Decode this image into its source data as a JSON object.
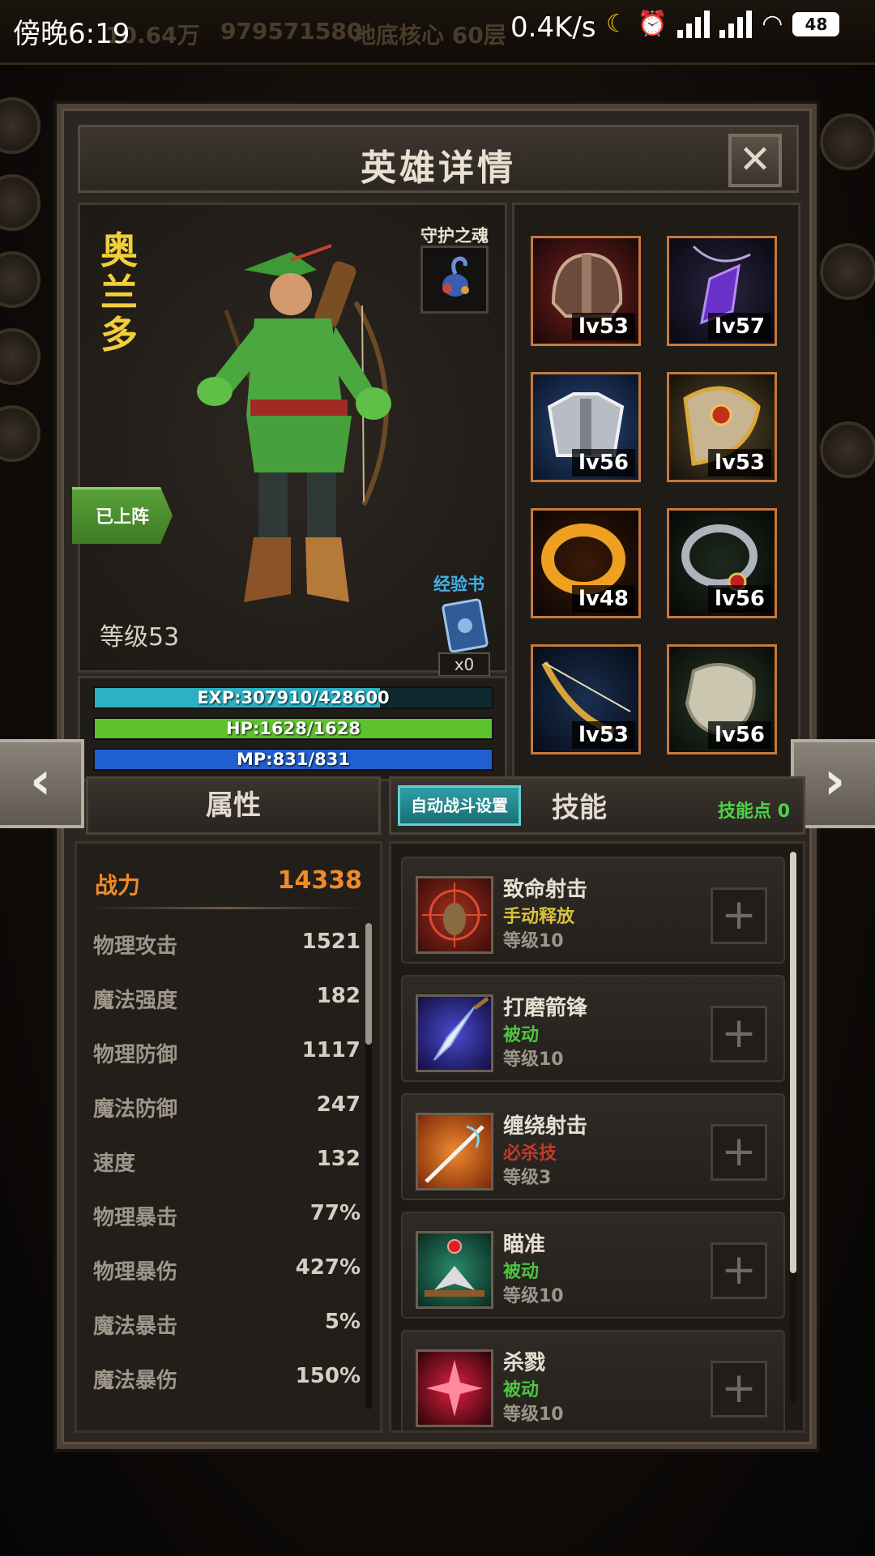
{
  "status_bar": {
    "time": "傍晚6:19",
    "network_speed": "0.4K/s",
    "battery": "48"
  },
  "background_top": {
    "gold": "10.64万",
    "diamonds": "979571580",
    "location": "地底核心 60层"
  },
  "dialog": {
    "title": "英雄详情",
    "close_label": "✕"
  },
  "hero": {
    "name": "奥兰多",
    "deployed_label": "已上阵",
    "guardian_label": "守护之魂",
    "level_text": "等级53",
    "exp_book_label": "经验书",
    "exp_book_count": "x0",
    "exp_text": "EXP:307910/428600",
    "exp_fraction": 0.718,
    "hp_text": "HP:1628/1628",
    "hp_fraction": 1.0,
    "mp_text": "MP:831/831",
    "mp_fraction": 1.0
  },
  "equipment": [
    {
      "icon": "helmet-icon",
      "level": "lv53"
    },
    {
      "icon": "amulet-icon",
      "level": "lv57"
    },
    {
      "icon": "armor-icon",
      "level": "lv56"
    },
    {
      "icon": "shoulder-icon",
      "level": "lv53"
    },
    {
      "icon": "ring-gold-icon",
      "level": "lv48"
    },
    {
      "icon": "ring-silver-icon",
      "level": "lv56"
    },
    {
      "icon": "bow-icon",
      "level": "lv53"
    },
    {
      "icon": "boots-icon",
      "level": "lv56"
    }
  ],
  "navigation": {
    "prev_label": "‹",
    "next_label": "›"
  },
  "attributes": {
    "tab_label": "属性",
    "power_label": "战力",
    "power_value": "14338",
    "rows": [
      {
        "label": "物理攻击",
        "value": "1521"
      },
      {
        "label": "魔法强度",
        "value": "182"
      },
      {
        "label": "物理防御",
        "value": "1117"
      },
      {
        "label": "魔法防御",
        "value": "247"
      },
      {
        "label": "速度",
        "value": "132"
      },
      {
        "label": "物理暴击",
        "value": "77%"
      },
      {
        "label": "物理暴伤",
        "value": "427%"
      },
      {
        "label": "魔法暴击",
        "value": "5%"
      },
      {
        "label": "魔法暴伤",
        "value": "150%"
      }
    ]
  },
  "skills": {
    "auto_battle_label": "自动战斗设置",
    "tab_label": "技能",
    "points_label": "技能点 0",
    "plus_label": "+",
    "list": [
      {
        "name": "致命射击",
        "type": "手动释放",
        "type_color": "#d9c23a",
        "level": "等级10",
        "icon": "crosshair-icon"
      },
      {
        "name": "打磨箭锋",
        "type": "被动",
        "type_color": "#4fc43f",
        "level": "等级10",
        "icon": "arrowhead-icon"
      },
      {
        "name": "缠绕射击",
        "type": "必杀技",
        "type_color": "#c23a2a",
        "level": "等级3",
        "icon": "fire-arrow-icon"
      },
      {
        "name": "瞄准",
        "type": "被动",
        "type_color": "#4fc43f",
        "level": "等级10",
        "icon": "aim-icon"
      },
      {
        "name": "杀戮",
        "type": "被动",
        "type_color": "#4fc43f",
        "level": "等级10",
        "icon": "burst-icon"
      }
    ]
  },
  "colors": {
    "exp_bar": "#2bb0c4",
    "hp_bar": "#5ec22e",
    "mp_bar": "#1f5fd0",
    "power": "#f08a28",
    "equip_border": "#c6793c"
  }
}
